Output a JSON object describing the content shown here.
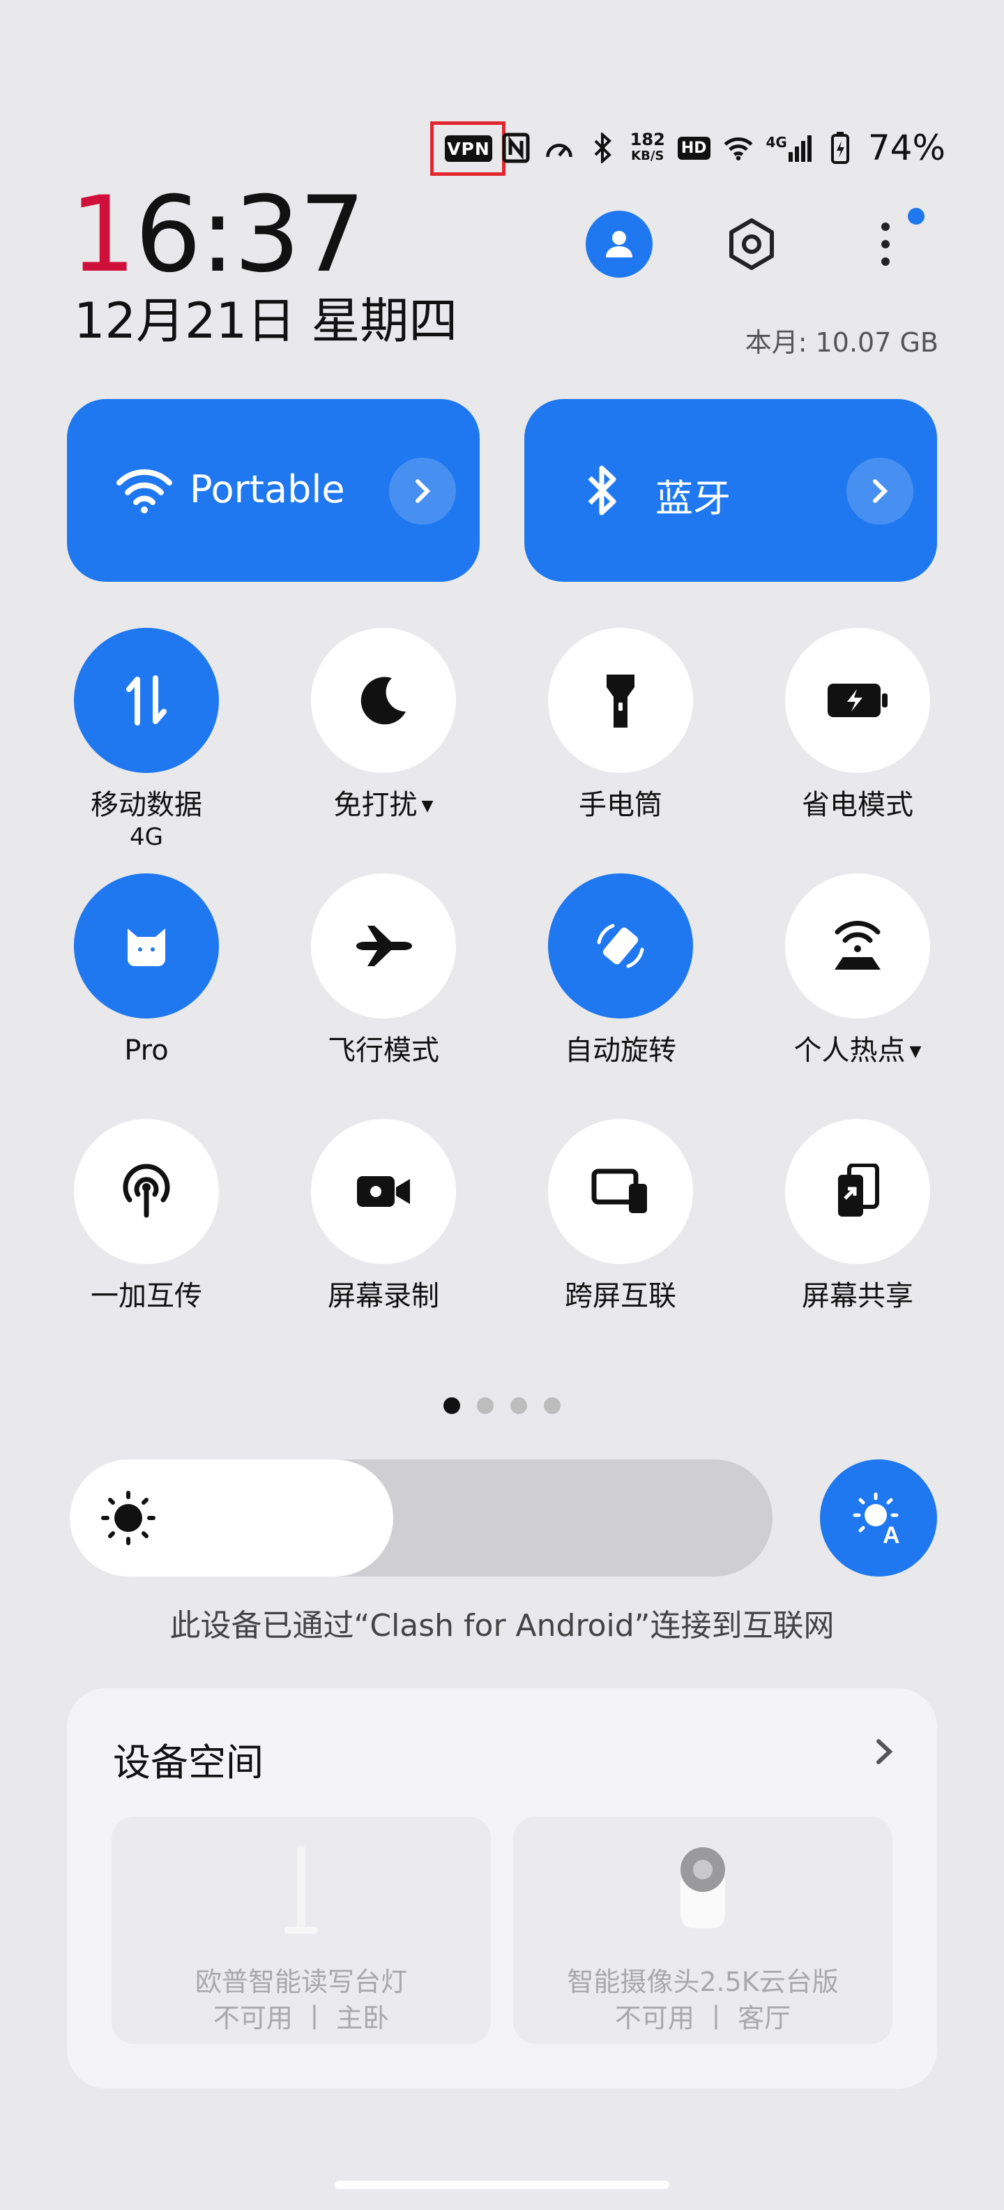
{
  "status_bar": {
    "vpn": "VPN",
    "net_speed_top": "182",
    "net_speed_unit": "KB/S",
    "hd": "HD",
    "network_type": "4G",
    "battery": "74%"
  },
  "header": {
    "time_first_digit": "1",
    "time_rest": "6:37",
    "date": "12月21日 星期四",
    "data_usage": "本月: 10.07 GB"
  },
  "big_tiles": {
    "wifi": {
      "label": "Portable",
      "icon": "wifi-icon"
    },
    "bluetooth": {
      "label": "蓝牙",
      "icon": "bluetooth-icon"
    }
  },
  "toggles": [
    {
      "label": "移动数据",
      "sub": "4G",
      "active": true,
      "icon": "mobile-data-icon"
    },
    {
      "label": "免打扰",
      "caret": true,
      "active": false,
      "icon": "moon-icon"
    },
    {
      "label": "手电筒",
      "active": false,
      "icon": "flashlight-icon"
    },
    {
      "label": "省电模式",
      "active": false,
      "icon": "battery-saver-icon"
    },
    {
      "label": "Pro",
      "active": true,
      "icon": "cat-icon"
    },
    {
      "label": "飞行模式",
      "active": false,
      "icon": "airplane-icon"
    },
    {
      "label": "自动旋转",
      "active": true,
      "icon": "auto-rotate-icon"
    },
    {
      "label": "个人热点",
      "caret": true,
      "active": false,
      "icon": "hotspot-icon"
    },
    {
      "label": "一加互传",
      "active": false,
      "icon": "share-signal-icon"
    },
    {
      "label": "屏幕录制",
      "active": false,
      "icon": "screen-record-icon"
    },
    {
      "label": "跨屏互联",
      "active": false,
      "icon": "cross-screen-icon"
    },
    {
      "label": "屏幕共享",
      "active": false,
      "icon": "screen-share-icon"
    }
  ],
  "pager": {
    "pages": 4,
    "current": 1
  },
  "brightness": {
    "level": 0.46
  },
  "vpn_note": "此设备已通过“Clash for Android”连接到互联网",
  "device_space": {
    "title": "设备空间",
    "devices": [
      {
        "name": "欧普智能读写台灯",
        "state": "不可用 丨 主卧"
      },
      {
        "name": "智能摄像头2.5K云台版",
        "state": "不可用 丨 客厅"
      }
    ]
  },
  "colors": {
    "accent": "#1f78ef",
    "highlight_frame": "#e3262e",
    "time_red": "#d0103a"
  }
}
